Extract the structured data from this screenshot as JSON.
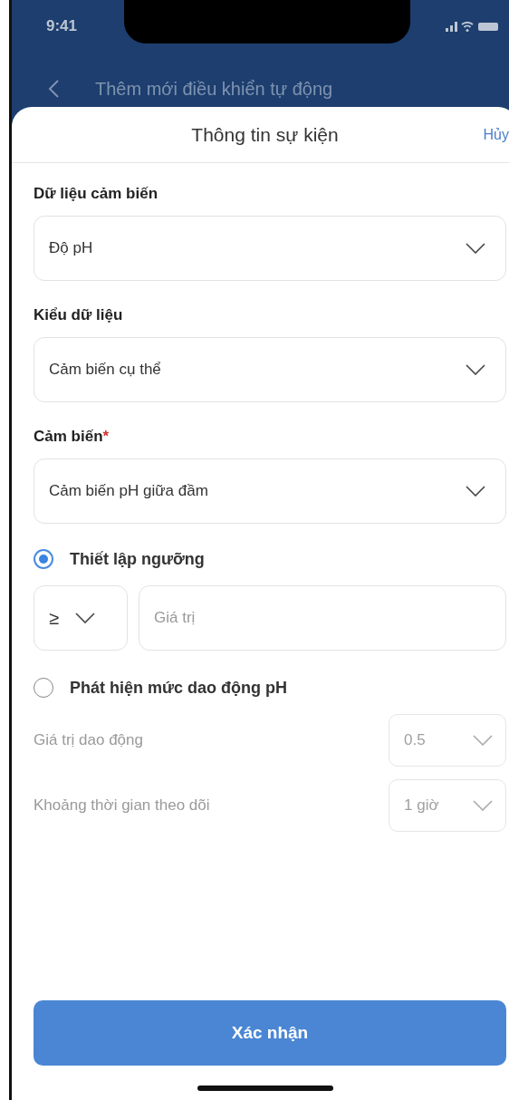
{
  "status_bar": {
    "time": "9:41"
  },
  "background_header": {
    "title": "Thêm mới điều khiển tự động"
  },
  "sheet": {
    "title": "Thông tin sự kiện",
    "cancel": "Hủy"
  },
  "fields": [
    {
      "label": "Dữ liệu cảm biến",
      "value": "Độ pH"
    },
    {
      "label": "Kiểu dữ liệu",
      "value": "Cảm biến cụ thể"
    },
    {
      "label": "Cảm biến",
      "value": "Cảm biến pH giữa đầm",
      "required_mark": "*"
    }
  ],
  "options": [
    {
      "label": "Thiết lập ngưỡng",
      "selected": true,
      "kind": "threshold",
      "operator": "≥",
      "placeholder": "Giá trị"
    },
    {
      "label": "Phát hiện mức dao động pH",
      "selected": false,
      "kind": "oscillation",
      "settings": [
        {
          "label": "Giá trị dao động",
          "value": "0.5",
          "disabled": true
        },
        {
          "label": "Khoảng thời gian theo dõi",
          "value": "1 giờ",
          "disabled": true
        }
      ]
    }
  ],
  "confirm_button": "Xác nhận"
}
